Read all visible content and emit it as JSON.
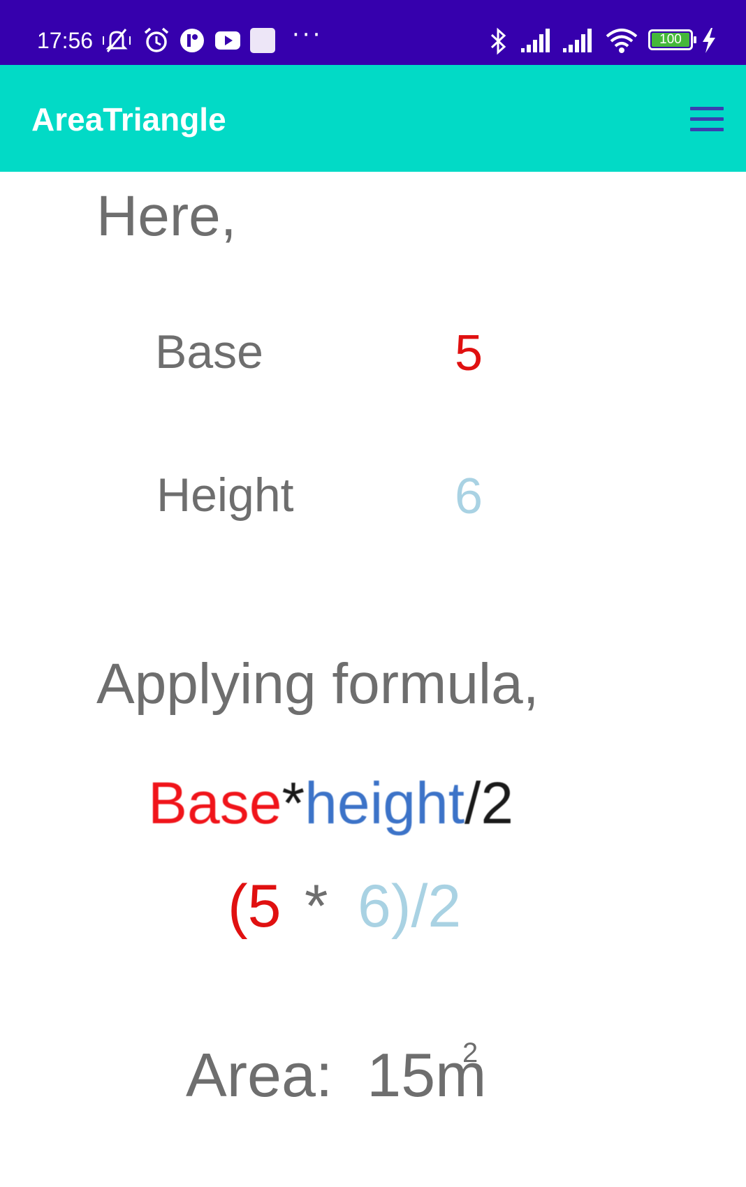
{
  "status_bar": {
    "time": "17:56",
    "dots": "···",
    "battery": "100",
    "icons": [
      "mute-vibrate-icon",
      "alarm-icon",
      "app-notification-icon",
      "youtube-icon",
      "square-notification-icon",
      "bluetooth-icon",
      "signal-1-icon",
      "signal-2-icon",
      "wifi-icon",
      "battery-icon",
      "charging-icon"
    ],
    "background": "#3600ad"
  },
  "app_bar": {
    "title": "AreaTriangle",
    "background": "#02dac6",
    "menu_icon": "hamburger-menu-icon"
  },
  "content": {
    "intro": "Here,",
    "base_label": "Base",
    "base_value": "5",
    "height_label": "Height",
    "height_value": "6",
    "applying": "Applying formula,",
    "formula": {
      "base": "Base",
      "times": "*",
      "height": "height",
      "div": "/2"
    },
    "calculation": {
      "left": "(5",
      "op": "*",
      "right": "6)/2"
    },
    "area_label": "Area:",
    "area_value": "15m",
    "area_unit_power": "2",
    "colors": {
      "base": "#e01010",
      "height": "#a9d2e3",
      "text": "#6e6e6e"
    }
  }
}
